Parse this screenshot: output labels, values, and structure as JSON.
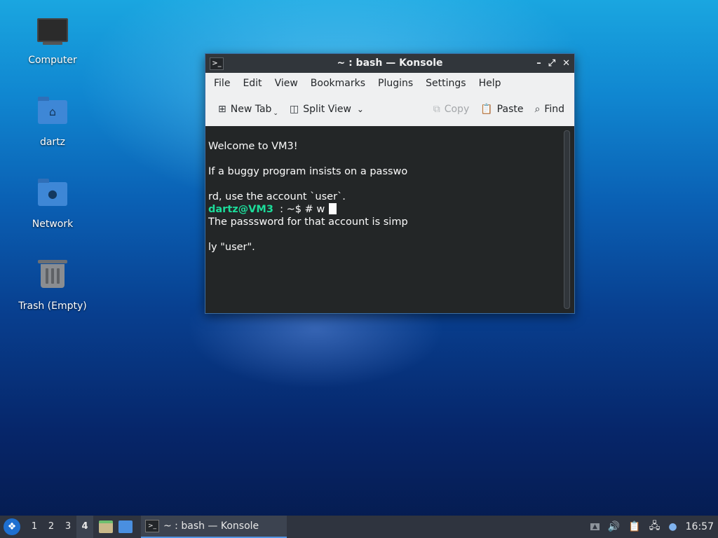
{
  "desktop": {
    "icons": [
      {
        "label": "Computer"
      },
      {
        "label": "dartz"
      },
      {
        "label": "Network"
      },
      {
        "label": "Trash (Empty)"
      }
    ]
  },
  "window": {
    "title": "~ : bash — Konsole",
    "menu": [
      "File",
      "Edit",
      "View",
      "Bookmarks",
      "Plugins",
      "Settings",
      "Help"
    ],
    "toolbar": {
      "new_tab": "New Tab",
      "split_view": "Split View",
      "copy": "Copy",
      "paste": "Paste",
      "find": "Find"
    },
    "terminal": {
      "lines": [
        "Welcome to VM3!",
        "If a buggy program insists on a passwo",
        "rd, use the account `user`.",
        "The passsword for that account is simp",
        "ly \"user\"."
      ],
      "prompt_user": "dartz@VM3",
      "prompt_rest": "  : ~$ # w",
      "colors": {
        "background": "#232627",
        "text": "#fcfcfc",
        "prompt": "#1cdc9a"
      }
    }
  },
  "taskbar": {
    "workspaces": [
      "1",
      "2",
      "3",
      "4"
    ],
    "active_workspace": "4",
    "task_label": "~ : bash — Konsole",
    "clock": "16:57",
    "accent": "#5294e2"
  }
}
